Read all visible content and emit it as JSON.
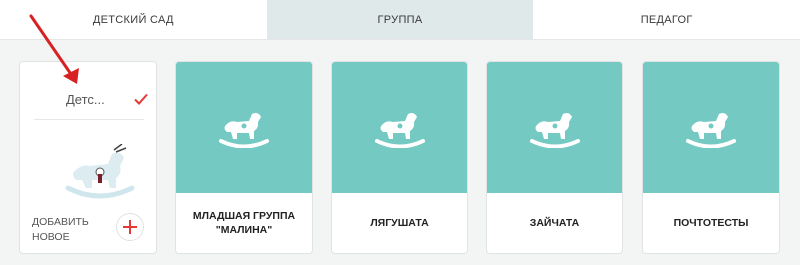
{
  "tabs": [
    {
      "label": "ДЕТСКИЙ САД",
      "active": false
    },
    {
      "label": "ГРУППА",
      "active": true
    },
    {
      "label": "ПЕДАГОГ",
      "active": false
    }
  ],
  "add_card": {
    "name": "Детс...",
    "add_label": "ДОБАВИТЬ НОВОЕ",
    "icons": [
      "check-icon",
      "rocking-horse-icon",
      "plus-icon"
    ]
  },
  "groups": [
    {
      "name": "МЛАДШАЯ ГРУППА\n\"МАЛИНА\""
    },
    {
      "name": "ЛЯГУШАТА"
    },
    {
      "name": "ЗАЙЧАТА"
    },
    {
      "name": "ПОЧТОТЕСТЫ"
    }
  ],
  "colors": {
    "tile": "#74c9c3",
    "active_tab": "#dfe9e9",
    "accent_red": "#e53935",
    "arrow": "#d62222"
  }
}
